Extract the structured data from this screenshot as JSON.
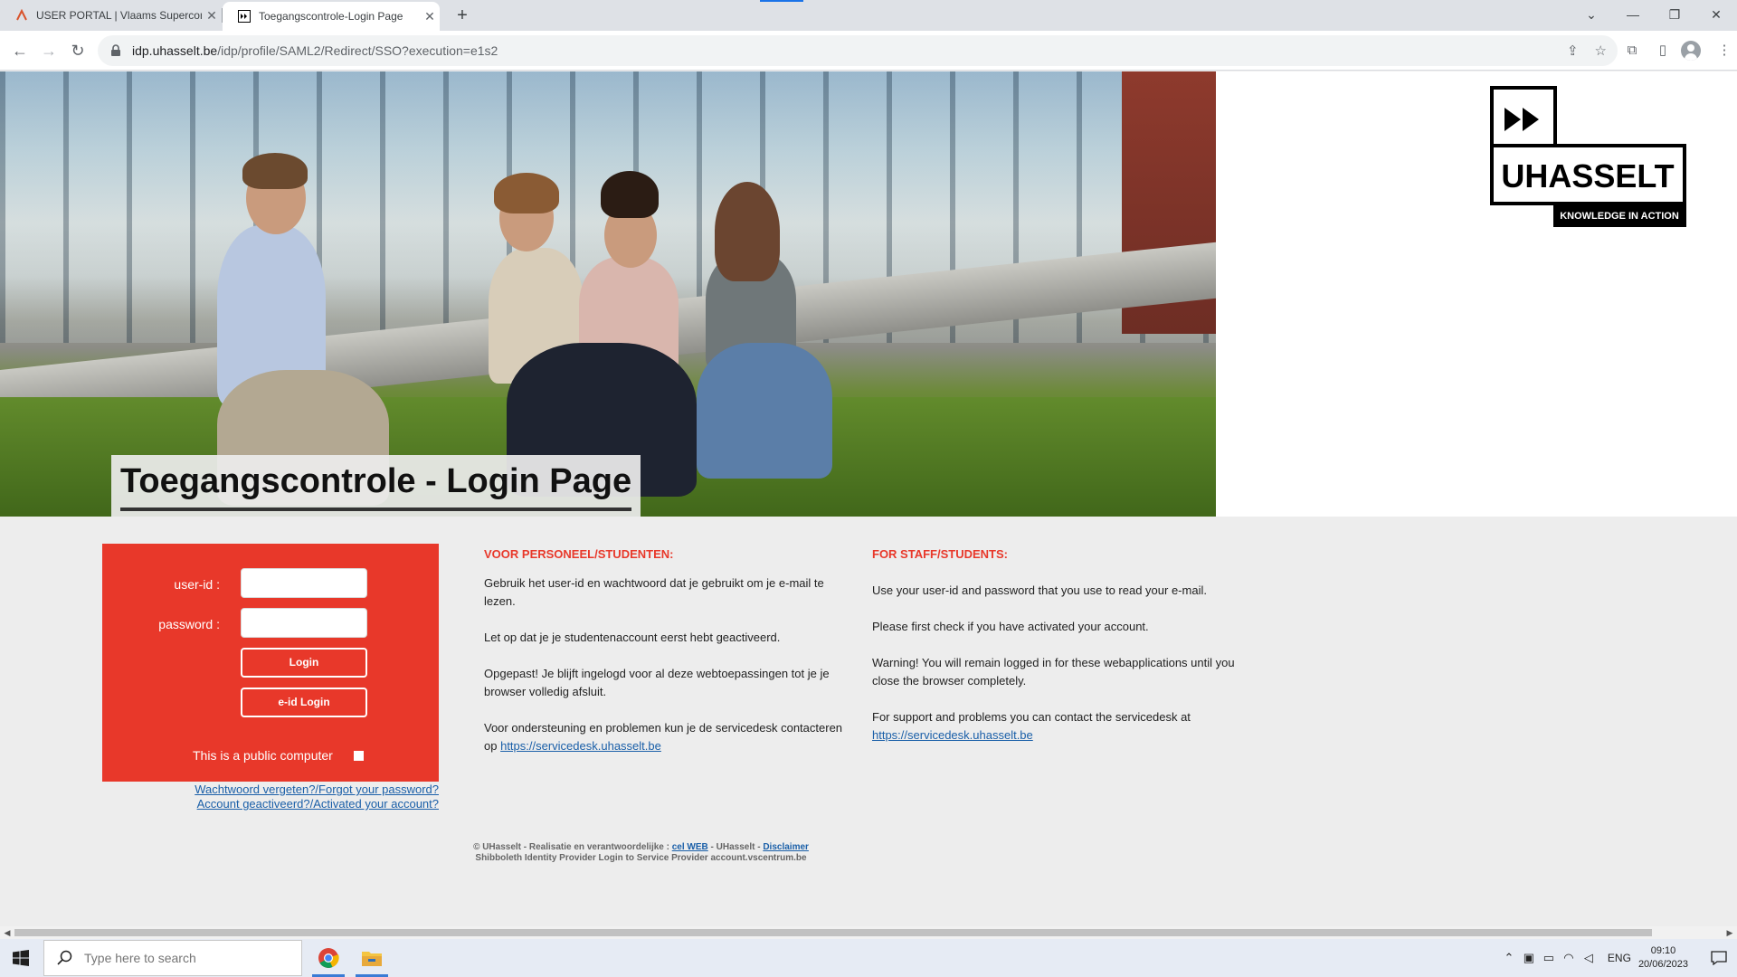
{
  "browser": {
    "tabs": [
      {
        "title": "USER PORTAL | Vlaams Supercom",
        "active": false
      },
      {
        "title": "Toegangscontrole-Login Page",
        "active": true
      }
    ],
    "url_host": "idp.uhasselt.be",
    "url_path": "/idp/profile/SAML2/Redirect/SSO?execution=e1s2"
  },
  "page": {
    "hero_title": "Toegangscontrole - Login Page",
    "logo": {
      "brand": "UHASSELT",
      "tagline": "KNOWLEDGE IN ACTION"
    },
    "login": {
      "userid_label": "user-id :",
      "password_label": "password :",
      "userid_value": "",
      "password_value": "",
      "login_button": "Login",
      "eid_button": "e-id Login",
      "public_computer_label": "This is a public computer"
    },
    "links": {
      "forgot": "Wachtwoord vergeten?/Forgot your password?",
      "activated": "Account geactiveerd?/Activated your account?"
    },
    "nl": {
      "heading": "VOOR PERSONEEL/STUDENTEN:",
      "p1": "Gebruik het user-id en wachtwoord dat je gebruikt om je e-mail te lezen.",
      "p2": "Let op dat je je studentenaccount eerst hebt geactiveerd.",
      "p3": "Opgepast! Je blijft ingelogd voor al deze webtoepassingen tot je je browser volledig afsluit.",
      "p4": "Voor ondersteuning en problemen kun je de servicedesk contacteren op",
      "link": "https://servicedesk.uhasselt.be"
    },
    "en": {
      "heading": "FOR STAFF/STUDENTS:",
      "p1": "Use your user-id and password that you use to read your e-mail.",
      "p2": "Please first check if you have activated your account.",
      "p3": "Warning! You will remain logged in for these webapplications until you close the browser completely.",
      "p4": "For support and problems you can contact the servicedesk at",
      "link": "https://servicedesk.uhasselt.be"
    },
    "footer": {
      "prefix": "© UHasselt - Realisatie en verantwoordelijke :",
      "celweb": "cel WEB",
      "mid": "- UHasselt -",
      "disclaimer": "Disclaimer",
      "line2": "Shibboleth Identity Provider Login to Service Provider account.vscentrum.be"
    }
  },
  "taskbar": {
    "search_placeholder": "Type here to search",
    "lang": "ENG",
    "time": "09:10",
    "date": "20/06/2023"
  },
  "colors": {
    "accent_red": "#e8382a",
    "link_blue": "#1a5fa8"
  }
}
